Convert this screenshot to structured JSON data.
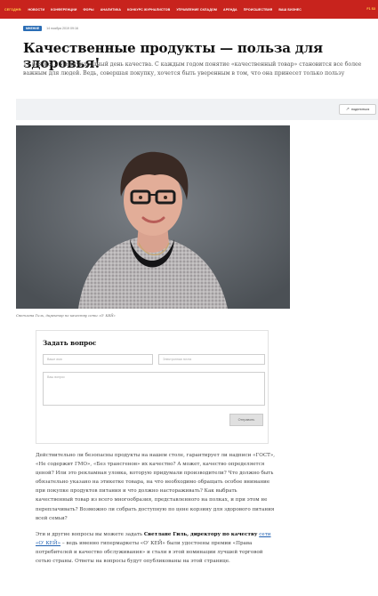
{
  "nav": {
    "items": [
      "Сегодня:",
      "Новости",
      "Конференции",
      "Форы",
      "Аналитика",
      "Конкурс журналистов",
      "Управление складом",
      "Аренда",
      "Происшествия",
      "Ваш бизнес"
    ],
    "extra": "F1 S3"
  },
  "article": {
    "rubric": "Мнение",
    "date": "14 ноября 2019 09:16",
    "title": "Качественные продукты — польза для здоровья!",
    "lead": "14 ноября – Международный день качества. С каждым годом понятие «качественный товар» становится все более важным для людей. Ведь, совершая покупку, хочется быть уверенным в том, что она принесет только пользу"
  },
  "share": {
    "label": "поделиться",
    "icon": "share-icon"
  },
  "photo": {
    "caption": "Светлана Гиль, директор по качеству сети «О' КЕЙ»"
  },
  "form": {
    "title": "Задать вопрос",
    "name_placeholder": "Ваше имя",
    "email_placeholder": "Электронная почта",
    "question_placeholder": "Ваш вопрос",
    "submit_label": "Отправить"
  },
  "body": {
    "paragraph1": "Действительно ли безопасны продукты на нашем столе, гарантирует ли надписи «ГОСТ», «Не содержит ГМО», «Без трансгенов» их качество? А может, качество определяется ценой? Или это рекламная уловка, которую придумали производители? Что должно быть обязательно указано на этикетке товара, на что необходимо обращать особое внимание при покупке продуктов питания и что должно настораживать? Как выбрать качественный товар из всего многообразия, представленного на полках, и при этом не переплачивать? Возможно ли собрать доступную по цене корзину для здорового питания всей семьи?",
    "p2_before": "Эти и другие вопросы вы можете задать ",
    "p2_strong": "Светлане Гиль, директору по качеству",
    "p2_link": "сети «О' КЕЙ»",
    "p2_after": " – ведь именно гипермаркеты «О' КЕЙ» были удостоены премии «Права потребителей и качество обслуживания» и стали в этой номинации лучшей торговой сетью страны. Ответы на вопросы будут опубликованы на этой странице."
  },
  "colors": {
    "nav_bg": "#c8231d",
    "link": "#1f5fb0",
    "rubric": "#2a6db5"
  }
}
